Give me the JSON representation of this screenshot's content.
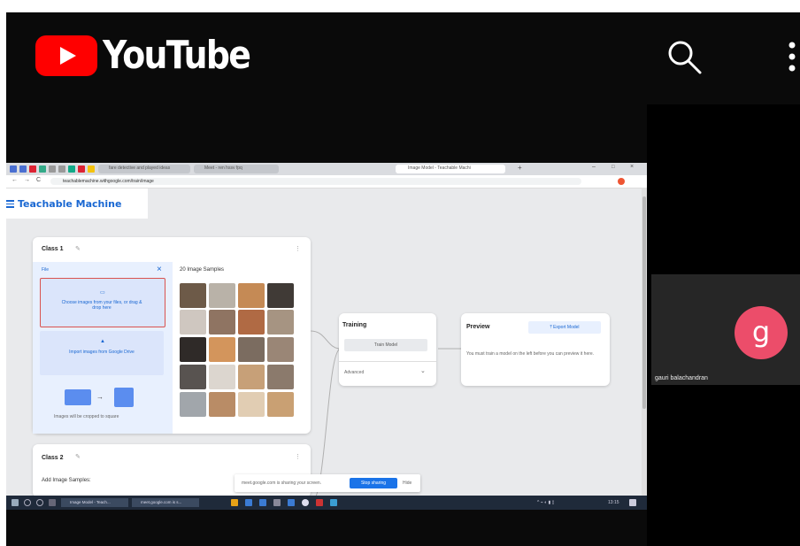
{
  "youtube": {
    "logo_text": "YouTube"
  },
  "browser": {
    "tabs": [
      {
        "label": "fare detective and played ideas"
      },
      {
        "label": "Meet - ren hssv fpq"
      },
      {
        "label": "Image Model - Teachable Machi"
      }
    ],
    "url": "teachablemachine.withgoogle.com/train/image"
  },
  "app": {
    "title": "Teachable Machine",
    "class1": {
      "title": "Class 1",
      "file_label": "File",
      "choose_text": "Choose images from your files, or drag & drop here",
      "import_text": "Import images from Google Drive",
      "crop_note": "Images will be cropped to square",
      "samples_label": "20 Image Samples"
    },
    "class2": {
      "title": "Class 2",
      "add_label": "Add Image Samples:"
    },
    "training": {
      "title": "Training",
      "train_button": "Train Model",
      "advanced": "Advanced"
    },
    "preview": {
      "title": "Preview",
      "export_button": "Export Model",
      "message": "You must train a model on the left before you can preview it here."
    },
    "sharing_bar": {
      "message": "meet.google.com is sharing your screen.",
      "stop_button": "Stop sharing",
      "hide_button": "Hide"
    }
  },
  "taskbar": {
    "apps": [
      {
        "label": "Image Model - Teach..."
      },
      {
        "label": "meet.google.com is s..."
      }
    ],
    "clock": "13:15"
  },
  "participant": {
    "initial": "g",
    "name": "gauri balachandran"
  },
  "colors": {
    "youtube_red": "#ff0000",
    "avatar": "#ec4d6a",
    "accent_blue": "#1967d2"
  }
}
